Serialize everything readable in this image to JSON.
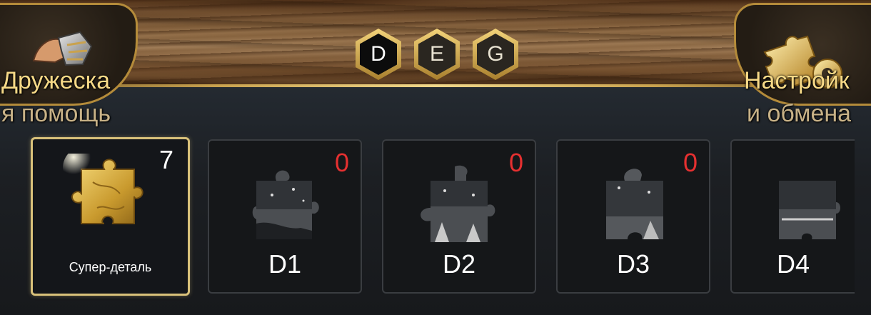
{
  "corner_left": {
    "line1": "Дружеска",
    "line2": "я помощь",
    "icon": "handshake-icon"
  },
  "corner_right": {
    "line1": "Настройк",
    "line2": "и обмена",
    "icon": "puzzle-gear-icon"
  },
  "tabs": [
    {
      "label": "D",
      "selected": true
    },
    {
      "label": "E",
      "selected": false
    },
    {
      "label": "G",
      "selected": false
    }
  ],
  "pieces": [
    {
      "name": "Супер-деталь",
      "count": "7",
      "kind": "super",
      "color": "#d4a937"
    },
    {
      "name": "D1",
      "count": "0",
      "kind": "fragment"
    },
    {
      "name": "D2",
      "count": "0",
      "kind": "fragment"
    },
    {
      "name": "D3",
      "count": "0",
      "kind": "fragment"
    },
    {
      "name": "D4",
      "count": "",
      "kind": "fragment"
    }
  ],
  "colors": {
    "count_zero": "#e53030",
    "gold": "#d4a937",
    "accent_border": "#d9c17a"
  }
}
